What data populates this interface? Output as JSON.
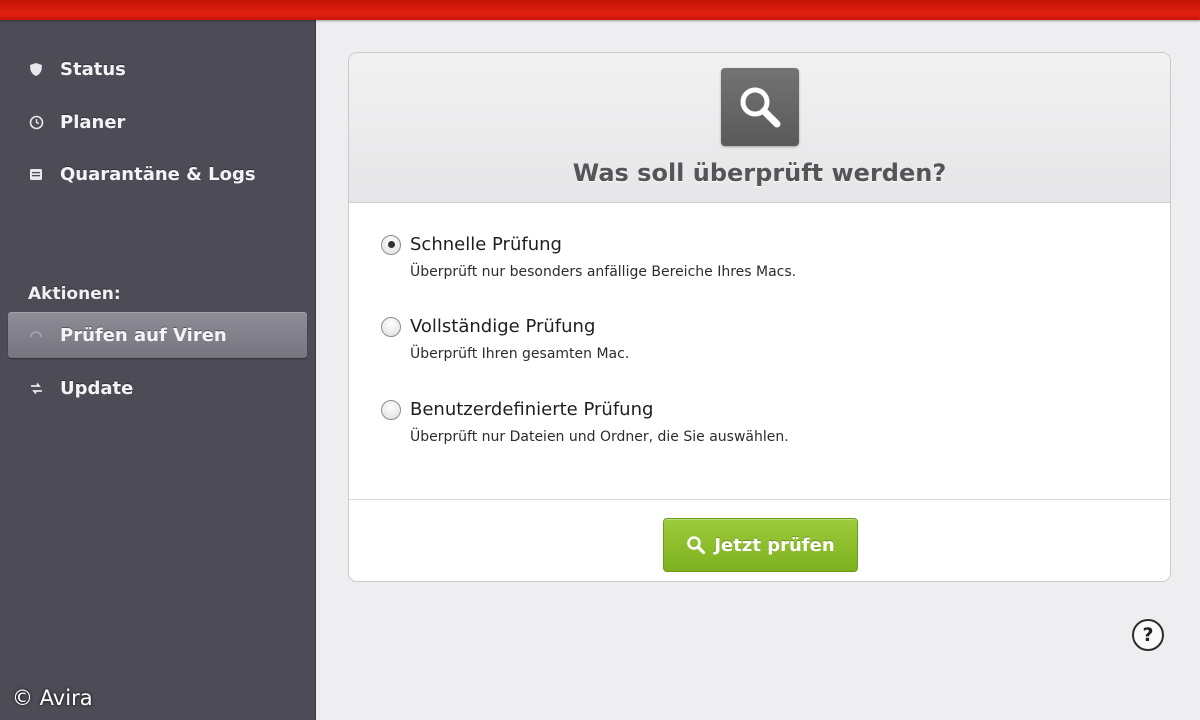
{
  "sidebar": {
    "items": [
      {
        "label": "Status",
        "icon": "shield-icon"
      },
      {
        "label": "Planer",
        "icon": "clock-icon"
      },
      {
        "label": "Quarantäne & Logs",
        "icon": "archive-icon"
      }
    ],
    "section_label": "Aktionen:",
    "actions": [
      {
        "label": "Prüfen auf Viren",
        "icon": "scan-icon",
        "active": true
      },
      {
        "label": "Update",
        "icon": "update-arrows-icon",
        "active": false
      }
    ]
  },
  "credit": "© Avira",
  "scan": {
    "question": "Was soll überprüft werden?",
    "options": [
      {
        "title": "Schnelle Prüfung",
        "description": "Überprüft nur besonders anfällige Bereiche Ihres Macs.",
        "selected": true
      },
      {
        "title": "Vollständige Prüfung",
        "description": "Überprüft Ihren gesamten Mac.",
        "selected": false
      },
      {
        "title": "Benutzerdefinierte Prüfung",
        "description": "Überprüft nur Dateien und Ordner, die Sie auswählen.",
        "selected": false
      }
    ],
    "button_label": "Jetzt prüfen"
  },
  "help_label": "?",
  "colors": {
    "top_bar": "#e2200f",
    "sidebar_bg": "#4c4b56",
    "button_green": "#8cbf2c"
  }
}
